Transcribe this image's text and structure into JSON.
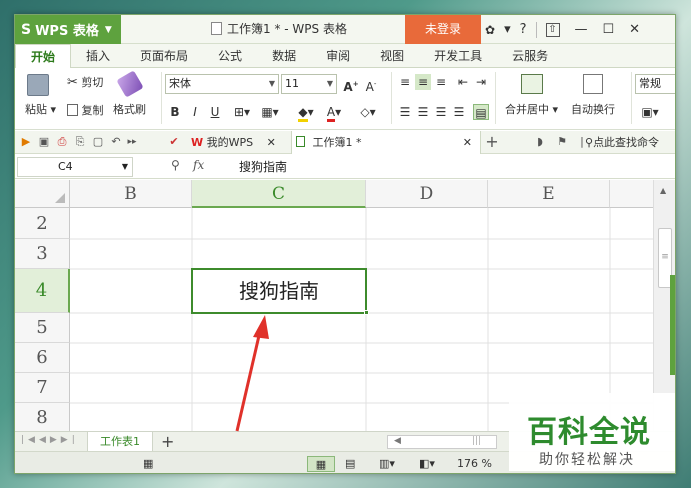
{
  "app": {
    "name": "WPS 表格",
    "logo_glyph": "S",
    "doc_title": "工作簿1 * - WPS 表格",
    "login": "未登录"
  },
  "window_controls": {
    "skin": "♦",
    "shirt": "👕",
    "help": "?",
    "pin": "⇧",
    "minimize": "—",
    "maximize": "☐",
    "close": "✕"
  },
  "tabs": [
    "开始",
    "插入",
    "页面布局",
    "公式",
    "数据",
    "审阅",
    "视图",
    "开发工具",
    "云服务"
  ],
  "ribbon": {
    "paste": "粘贴",
    "cut": "剪切",
    "copy": "复制",
    "format_painter": "格式刷",
    "font_name": "宋体",
    "font_size": "11",
    "bold": "B",
    "italic": "I",
    "underline": "U",
    "merge_center": "合并居中",
    "wrap_text": "自动换行",
    "number_format": "常规"
  },
  "quickbar": {
    "doc_tabs": [
      {
        "label": "我的WPS",
        "logo": "W"
      },
      {
        "label": "工作簿1 *"
      }
    ],
    "add_tab": "+",
    "search": "点此查找命令"
  },
  "formula_bar": {
    "cell_ref": "C4",
    "fx": "fx",
    "content": "搜狗指南"
  },
  "grid": {
    "columns": [
      "B",
      "C",
      "D",
      "E"
    ],
    "selected_column": "C",
    "rows": [
      "2",
      "3",
      "4",
      "5",
      "6",
      "7",
      "8"
    ],
    "selected_row": "4",
    "active_cell_value": "搜狗指南"
  },
  "sheets": {
    "tabs": [
      "工作表1"
    ],
    "add": "+"
  },
  "status": {
    "zoom": "176 %"
  },
  "watermark": {
    "title": "百科全说",
    "subtitle": "助你轻松解决"
  },
  "colors": {
    "brand_green": "#5ea23e",
    "login_orange": "#e86a3a",
    "select_green": "#3d8b2c",
    "arrow_red": "#e0312a"
  }
}
